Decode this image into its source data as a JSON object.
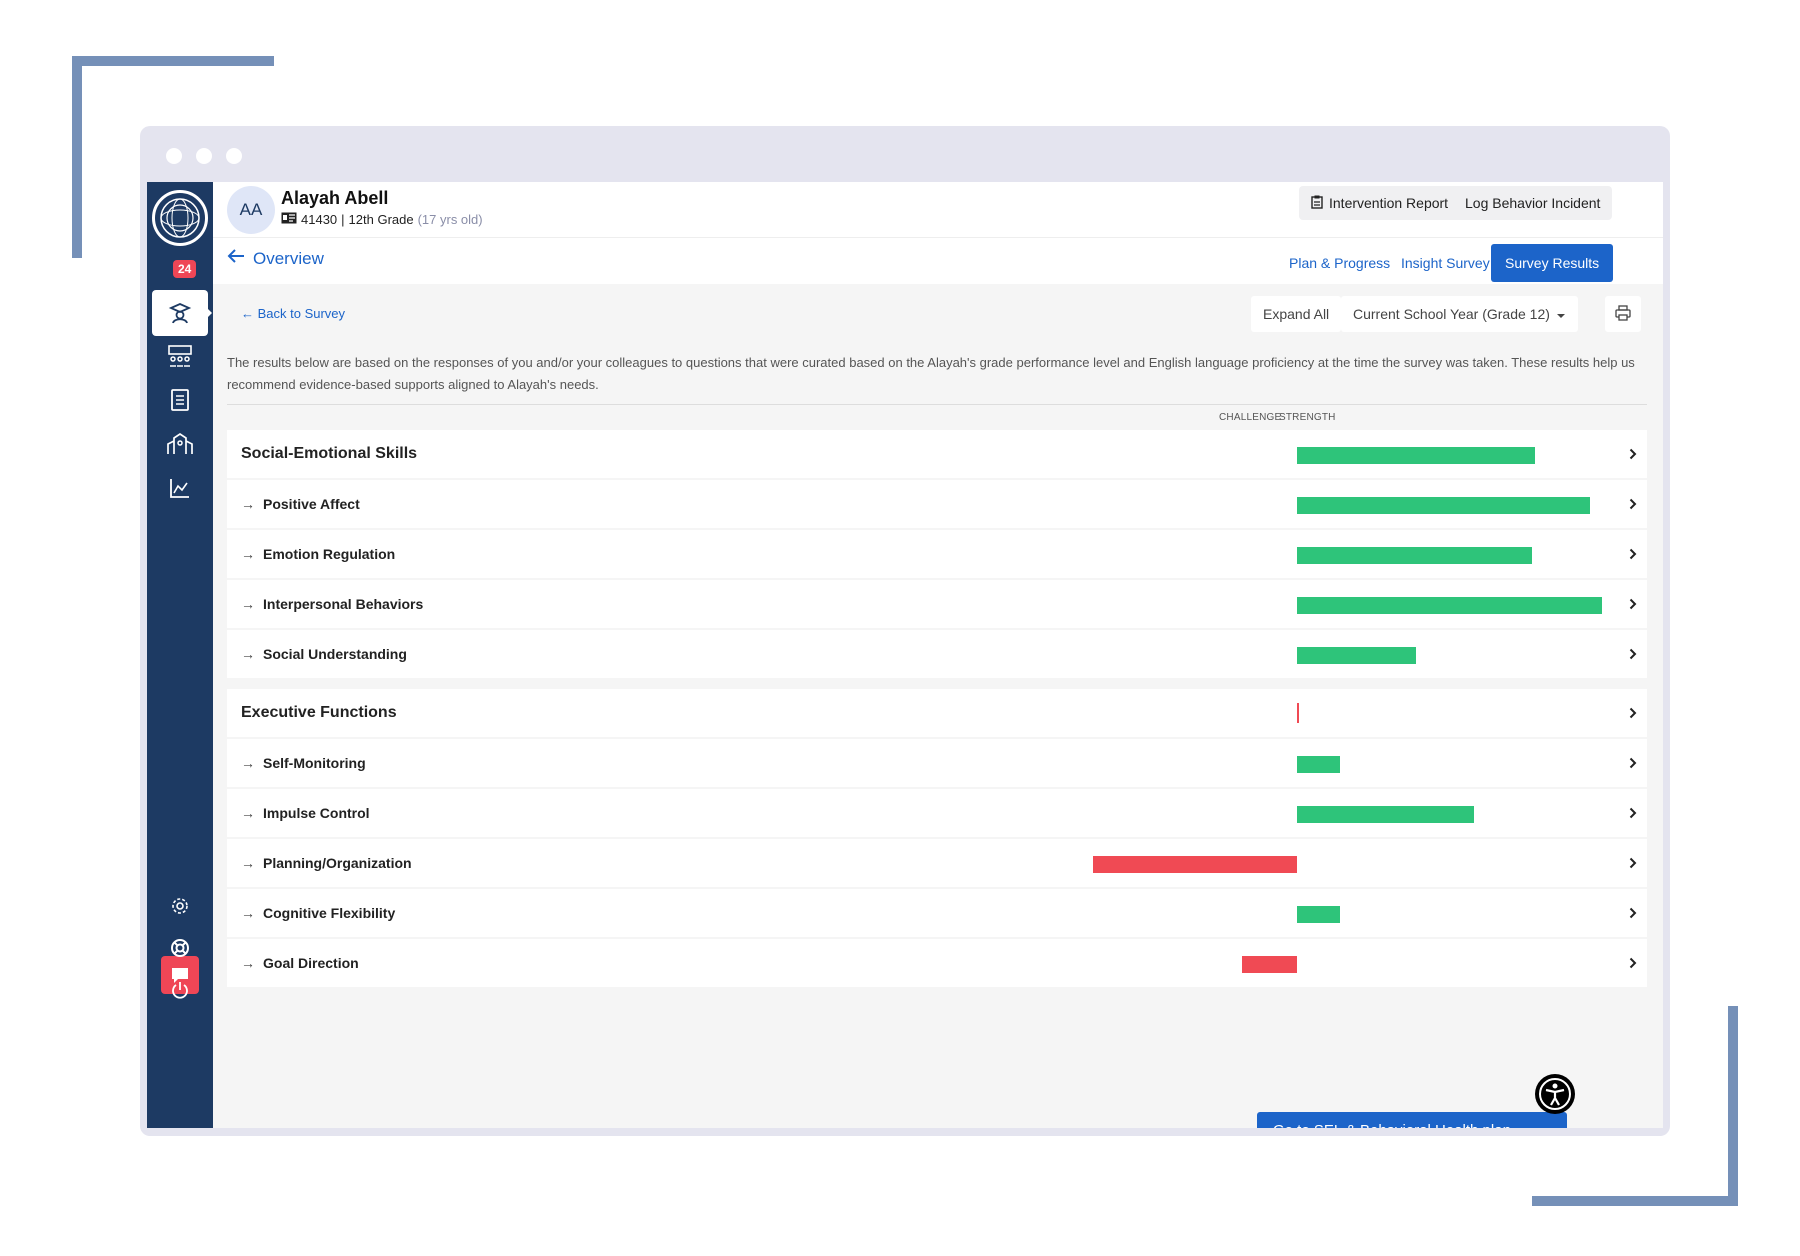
{
  "student": {
    "initials": "AA",
    "name": "Alayah Abell",
    "id": "41430",
    "grade": "12th Grade",
    "age": "(17 yrs old)"
  },
  "header": {
    "intervention_report": "Intervention Report",
    "log_incident": "Log Behavior Incident"
  },
  "sidebar": {
    "badge_count": "24",
    "icons": [
      "logo-icon",
      "check-icon",
      "student-icon",
      "classroom-icon",
      "book-icon",
      "school-icon",
      "chart-icon",
      "chat-icon",
      "gear-icon",
      "help-icon",
      "power-icon"
    ]
  },
  "subnav": {
    "overview": "Overview",
    "tabs": [
      "Plan & Progress",
      "Insight Survey",
      "Survey Results"
    ],
    "active_tab": "Survey Results"
  },
  "toolbar": {
    "back": "← Back to Survey",
    "expand_all": "Expand All",
    "year_select": "Current School Year (Grade 12)"
  },
  "description": "The results below are based on the responses of you and/or your colleagues to questions that were curated based on the Alayah's grade performance level and English language proficiency at the time the survey was taken. These results help us recommend evidence-based supports aligned to Alayah's needs.",
  "axis": {
    "challenge": "CHALLENGE",
    "strength": "STRENGTH"
  },
  "chart_data": {
    "type": "bar",
    "orientation": "horizontal-diverging",
    "xlim": [
      -1,
      1
    ],
    "groups": [
      {
        "name": "Social-Emotional Skills",
        "value": 0.78,
        "items": [
          {
            "name": "Positive Affect",
            "value": 0.96
          },
          {
            "name": "Emotion Regulation",
            "value": 0.77
          },
          {
            "name": "Interpersonal Behaviors",
            "value": 1.0
          },
          {
            "name": "Social Understanding",
            "value": 0.39
          }
        ]
      },
      {
        "name": "Executive Functions",
        "value": 0.0,
        "items": [
          {
            "name": "Self-Monitoring",
            "value": 0.14
          },
          {
            "name": "Impulse Control",
            "value": 0.58
          },
          {
            "name": "Planning/Organization",
            "value": -0.67
          },
          {
            "name": "Cognitive Flexibility",
            "value": 0.14
          },
          {
            "name": "Goal Direction",
            "value": -0.18
          }
        ]
      }
    ],
    "colors": {
      "strength": "#2ec47a",
      "challenge": "#f04a54"
    }
  },
  "cta": "Go to SEL & Behavioral Health plan"
}
